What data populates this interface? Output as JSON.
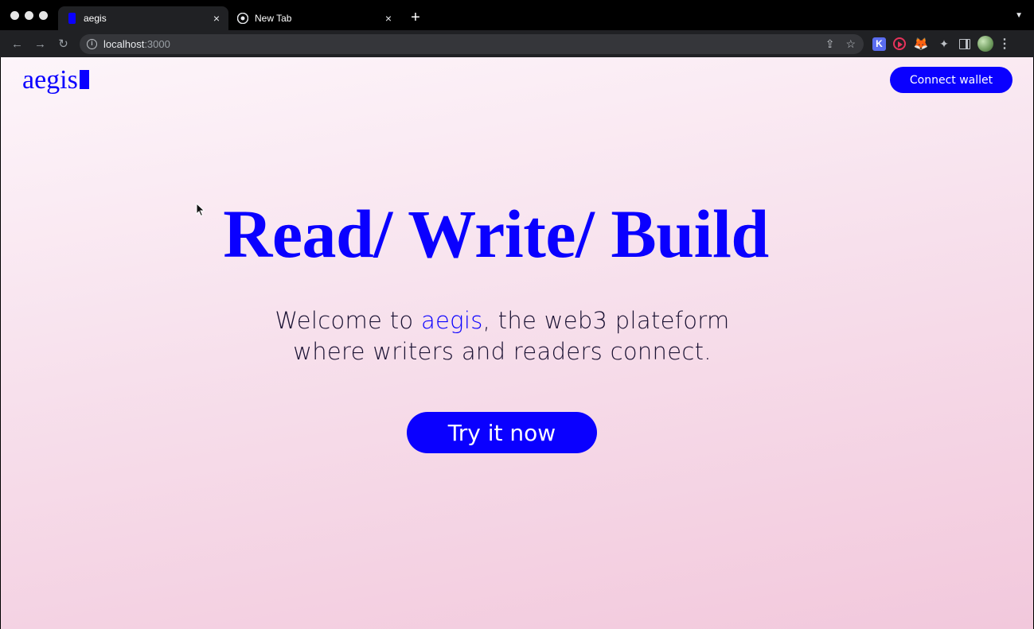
{
  "browser": {
    "tabs": [
      {
        "title": "aegis",
        "active": true
      },
      {
        "title": "New Tab",
        "active": false
      }
    ],
    "new_tab_symbol": "+",
    "close_symbol": "×",
    "url_host": "localhost",
    "url_port": ":3000",
    "extensions": [
      "K-icon",
      "screen-record-icon",
      "metamask-fox-icon",
      "puzzle-extensions-icon",
      "side-panel-icon",
      "profile-avatar"
    ],
    "ext_k_label": "K"
  },
  "page": {
    "logo": "aegis",
    "connect_label": "Connect wallet",
    "hero_title": "Read/ Write/ Build",
    "subtitle_before": "Welcome to ",
    "subtitle_brand": "aegis",
    "subtitle_after_line1": ", the web3 plateform",
    "subtitle_line2": "where writers and readers connect.",
    "cta_label": "Try it now"
  },
  "colors": {
    "accent": "#0a00ff",
    "chrome_bg": "#202124",
    "page_gradient_top": "#fdf5fa",
    "page_gradient_bottom": "#f2c8dc"
  }
}
